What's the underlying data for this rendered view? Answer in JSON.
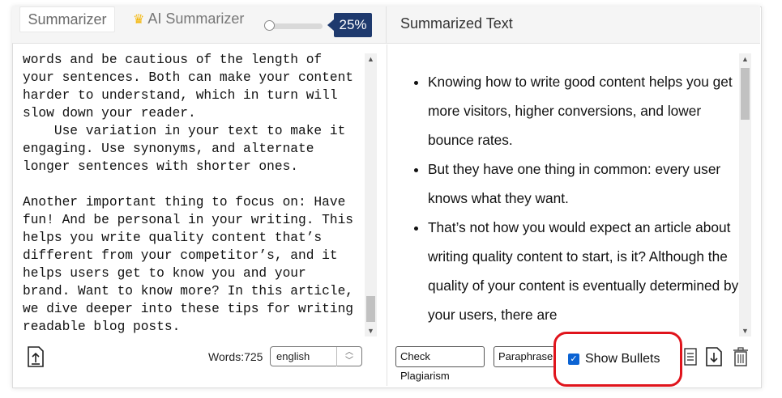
{
  "header": {
    "tab_summarizer": "Summarizer",
    "tab_ai_summarizer": "AI Summarizer",
    "summary_percent": "25%",
    "summary_length_fraction": 0.0,
    "summarized_title": "Summarized Text"
  },
  "input": {
    "text": "words and be cautious of the length of\nyour sentences. Both can make your content\nharder to understand, which in turn will\nslow down your reader.\n    Use variation in your text to make it\nengaging. Use synonyms, and alternate\nlonger sentences with shorter ones.\n\nAnother important thing to focus on: Have\nfun! And be personal in your writing. This\nhelps you write quality content that’s\ndifferent from your competitor’s, and it\nhelps users get to know you and your\nbrand. Want to know more? In this article,\nwe dive deeper into these tips for writing\nreadable blog posts.",
    "words_label": "Words:725",
    "language": "english"
  },
  "output": {
    "bullets": [
      "Knowing how to write good content helps you get more visitors, higher conversions, and lower bounce rates.",
      "But they have one thing in common: every user knows what they want.",
      "That’s not how you would expect an article about writing quality content to start, is it? Although the quality of your content is eventually determined by your users, there are"
    ],
    "check_plagiarism_label": "Check Plagiarism",
    "paraphrase_label": "Paraphrase",
    "show_bullets_label": "Show Bullets",
    "show_bullets_checked": true
  },
  "colors": {
    "accent": "#1f3a6e",
    "highlight_red": "#e0141c",
    "checkbox_blue": "#0b63d3",
    "crown": "#f4b400"
  }
}
